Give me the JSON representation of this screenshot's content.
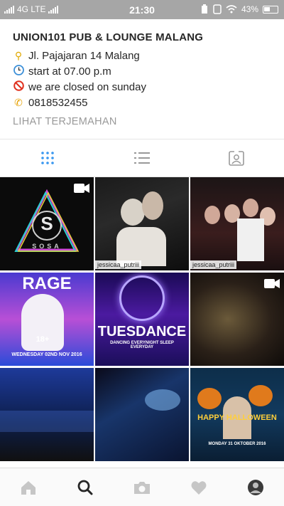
{
  "status": {
    "carrier_left": "4G LTE",
    "time": "21:30",
    "battery": "43%"
  },
  "profile": {
    "name": "UNION101 PUB & LOUNGE  MALANG",
    "address": "Jl. Pajajaran 14 Malang",
    "hours": "start at 07.00 p.m",
    "closed": "we are closed on sunday",
    "phone": "0818532455",
    "translate": "LIHAT TERJEMAHAN"
  },
  "tabs": [
    {
      "name": "grid",
      "active": true
    },
    {
      "name": "list",
      "active": false
    },
    {
      "name": "tagged",
      "active": false
    }
  ],
  "posts": [
    {
      "title": "S",
      "subtitle": "SOSA",
      "video": true
    },
    {
      "tag": "jessicaa_putriii",
      "video": false
    },
    {
      "tag": "jessicaa_putriii",
      "video": false
    },
    {
      "title": "RAGE",
      "subtitle": "WEDNESDAY 02ND NOV 2016",
      "badge": "18+",
      "video": false
    },
    {
      "title": "TUESDANCE",
      "subtitle": "DANCING EVERYNIGHT SLEEP EVERYDAY",
      "video": false
    },
    {
      "video": true
    },
    {
      "video": false
    },
    {
      "video": false
    },
    {
      "title": "HAPPY HALLOWEEN",
      "subtitle": "MONDAY 31 OKTOBER 2016",
      "video": false
    }
  ],
  "nav": [
    "home",
    "search",
    "camera",
    "activity",
    "profile"
  ],
  "colors": {
    "accent": "#3897f0",
    "status_bar": "#a6a6a6"
  }
}
